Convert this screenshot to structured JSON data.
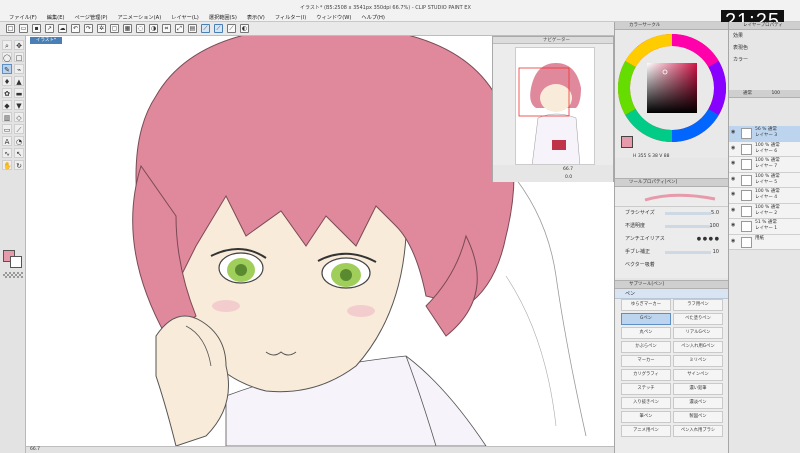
{
  "window": {
    "title": "イラスト* (B5:2508 x 3541px 350dpi 66.7%) - CLIP STUDIO PAINT EX",
    "clock": "21:25"
  },
  "menu": {
    "items": [
      "ファイル(F)",
      "編集(E)",
      "ページ管理(P)",
      "アニメーション(A)",
      "レイヤー(L)",
      "選択範囲(S)",
      "表示(V)",
      "フィルター(I)",
      "ウィンドウ(W)",
      "ヘルプ(H)"
    ]
  },
  "canvas": {
    "tab_label": "イラスト*",
    "status_zoom": "66.7"
  },
  "navigator": {
    "title": "ナビゲーター",
    "zoom": "66.7",
    "rotation": "0.0"
  },
  "color_panel": {
    "title": "カラーサークル",
    "readout": "H 355  S 38  V 88",
    "current_color": "#e79aaa"
  },
  "tool_property": {
    "title": "ツールプロパティ[ペン]",
    "rows": [
      {
        "label": "ブラシサイズ",
        "value": "5.0"
      },
      {
        "label": "不透明度",
        "value": "100"
      },
      {
        "label": "アンチエイリアス",
        "value": ""
      },
      {
        "label": "手ブレ補正",
        "value": "10"
      },
      {
        "label": "ベクター吸着",
        "value": ""
      }
    ]
  },
  "subtool": {
    "title": "サブツール[ペン]",
    "tab": "ペン",
    "brushes": [
      "ゆらぎマーカー",
      "ラフ用ペン",
      "Gペン",
      "ベた塗りペン",
      "丸ペン",
      "リアルGペン",
      "かぶらペン",
      "ペン入れ用Gペン",
      "マーカー",
      "ミリペン",
      "カリグラフィ",
      "サインペン",
      "ステッチ",
      "濃い鉛筆",
      "入り抜きペン",
      "濃淡ペン",
      "筆ペン",
      "製図ペン",
      "アニメ用ペン",
      "ペン入れ用ブラシ"
    ],
    "active_index": 2
  },
  "layer_panel": {
    "title": "レイヤープロパティ",
    "effect_label": "効果",
    "expression_label": "表現色",
    "expression_value": "カラー",
    "blend_mode": "通常",
    "opacity": "100",
    "layers": [
      {
        "name": "56 % 通常\nレイヤー 3",
        "active": true
      },
      {
        "name": "100 % 通常\nレイヤー 6",
        "active": false
      },
      {
        "name": "100 % 通常\nレイヤー 7",
        "active": false
      },
      {
        "name": "100 % 通常\nレイヤー 5",
        "active": false
      },
      {
        "name": "100 % 通常\nレイヤー 4",
        "active": false
      },
      {
        "name": "100 % 通常\nレイヤー 2",
        "active": false
      },
      {
        "name": "51 % 通常\nレイヤー 1",
        "active": false
      },
      {
        "name": "用紙",
        "active": false
      }
    ]
  }
}
